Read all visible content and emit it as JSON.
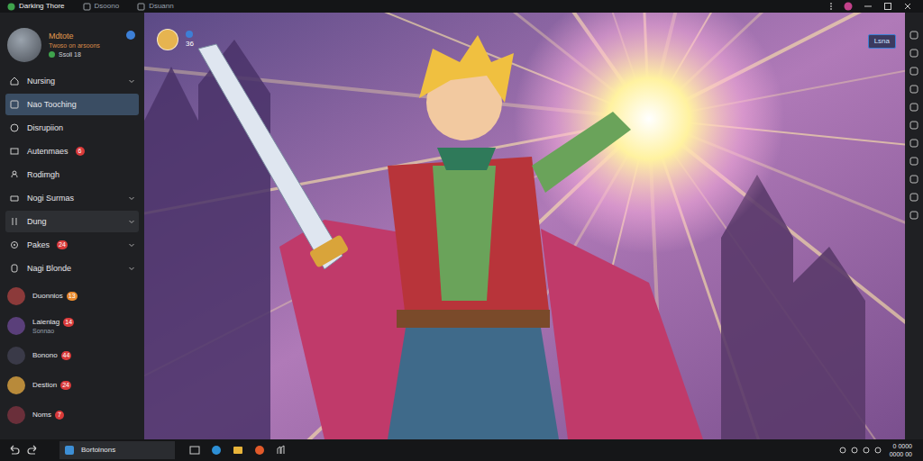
{
  "window": {
    "tabs": [
      {
        "label": "Darking Thore",
        "selected": true
      },
      {
        "label": "Dsoono",
        "selected": false
      },
      {
        "label": "Dsuann",
        "selected": false
      }
    ]
  },
  "profile": {
    "name": "Mdtote",
    "status": "Twoso on arsoons",
    "count": "Ssoll 18",
    "online": true
  },
  "sidebar": {
    "items": [
      {
        "label": "Nursing",
        "badge": "",
        "expandable": true,
        "selected": false,
        "highlighted": false
      },
      {
        "label": "Nao Tooching",
        "badge": "",
        "expandable": false,
        "selected": true,
        "highlighted": false
      },
      {
        "label": "Disrupiion",
        "badge": "",
        "expandable": false,
        "selected": false,
        "highlighted": false
      },
      {
        "label": "Autenmaes",
        "badge": "6",
        "expandable": false,
        "selected": false,
        "highlighted": false
      },
      {
        "label": "Rodimgh",
        "badge": "",
        "expandable": false,
        "selected": false,
        "highlighted": false
      },
      {
        "label": "Nogi Surmas",
        "badge": "",
        "expandable": true,
        "selected": false,
        "highlighted": false
      },
      {
        "label": "Dung",
        "badge": "",
        "expandable": true,
        "selected": false,
        "highlighted": true
      },
      {
        "label": "Pakes",
        "badge": "24",
        "expandable": true,
        "selected": false,
        "highlighted": false
      },
      {
        "label": "Nagi Blonde",
        "badge": "",
        "expandable": true,
        "selected": false,
        "highlighted": false
      }
    ]
  },
  "friends": [
    {
      "name": "Duonnios",
      "sub": "",
      "badge": "13",
      "color": "#e8892c"
    },
    {
      "name": "Laienlag",
      "sub": "Sonnao",
      "badge": "14",
      "color": "#d93a3a"
    },
    {
      "name": "Bonono",
      "sub": "",
      "badge": "44",
      "color": "#d93a3a"
    },
    {
      "name": "Destion",
      "sub": "",
      "badge": "24",
      "color": "#d93a3a"
    },
    {
      "name": "Noms",
      "sub": "",
      "badge": "7",
      "color": "#d93a3a"
    }
  ],
  "content": {
    "count": "36",
    "button": "Lsna"
  },
  "taskbar": {
    "app": "Bortoinons",
    "time": "0 0000",
    "date": "0000 00"
  }
}
